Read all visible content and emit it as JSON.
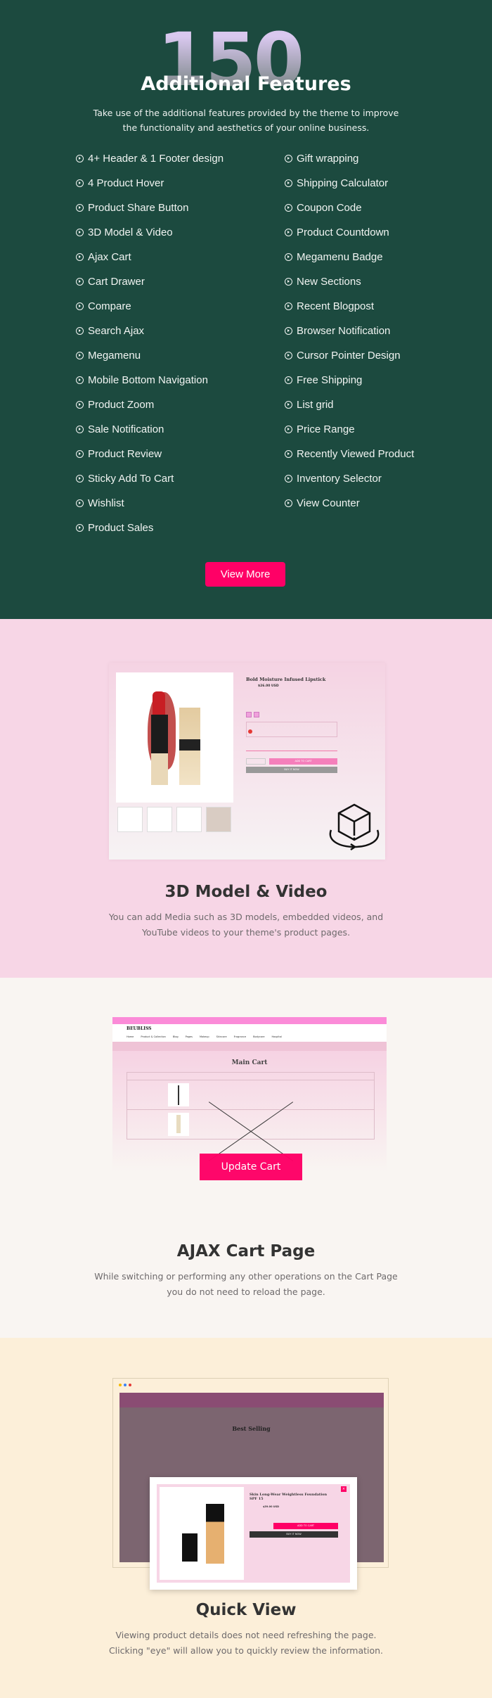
{
  "features_section": {
    "count": "150",
    "count_suffix": "+",
    "title": "Additional Features",
    "description_line1": "Take use of the additional features provided by the theme to improve",
    "description_line2": "the functionality and aesthetics of your online business.",
    "left_items": [
      "4+ Header & 1 Footer design",
      "4 Product Hover",
      "Product Share Button",
      "3D Model & Video",
      "Ajax Cart",
      "Cart Drawer",
      "Compare",
      "Search Ajax",
      "Megamenu",
      "Mobile Bottom Navigation",
      "Product Zoom",
      "Sale Notification",
      "Product Review",
      "Sticky Add To Cart",
      "Wishlist",
      "Product Sales"
    ],
    "right_items": [
      "Gift wrapping",
      "Shipping Calculator",
      "Coupon Code",
      "Product Countdown",
      "Megamenu Badge",
      "New Sections",
      "Recent Blogpost",
      "Browser Notification",
      "Cursor Pointer Design",
      "Free Shipping",
      "List grid",
      "Price Range",
      "Recently Viewed Product",
      "Inventory Selector",
      "View Counter"
    ],
    "view_more_label": "View More",
    "background_color": "#1c4a3f",
    "accent_color": "#ff0066"
  },
  "model_section": {
    "title": "3D Model & Video",
    "description_line1": "You can add Media such as 3D models, embedded videos, and",
    "description_line2": "YouTube videos to your theme's product pages.",
    "mock": {
      "product_title": "Bold Moisture Infused Lipstick",
      "price": "$26.00 USD",
      "add_to_cart": "ADD TO CART",
      "buy_now": "BUY IT NOW"
    },
    "icon": "3d-cube-rotate-icon"
  },
  "cart_section": {
    "title": "AJAX Cart Page",
    "description_line1": "While switching or performing any other operations on the Cart Page",
    "description_line2": "you do not need to reload the page.",
    "mock": {
      "logo": "BEUBLISS",
      "nav": [
        "Home",
        "Product & Collection",
        "Blog",
        "Pages",
        "Makeup",
        "Skincare",
        "Fragrance",
        "Bodycare",
        "Hospital"
      ],
      "heading": "Main Cart",
      "update_cart_label": "Update Cart"
    }
  },
  "quickview_section": {
    "title": "Quick View",
    "description_line1": "Viewing product details does not need refreshing the page.",
    "description_line2": "Clicking \"eye\" will allow you to quickly review the information.",
    "mock": {
      "heading": "Best Selling",
      "product_title": "Skin Long-Wear Weightless Foundation SPF 15",
      "price": "$39.00 USD",
      "add_to_cart": "ADD TO CART",
      "buy_now": "BUY IT NOW"
    }
  }
}
